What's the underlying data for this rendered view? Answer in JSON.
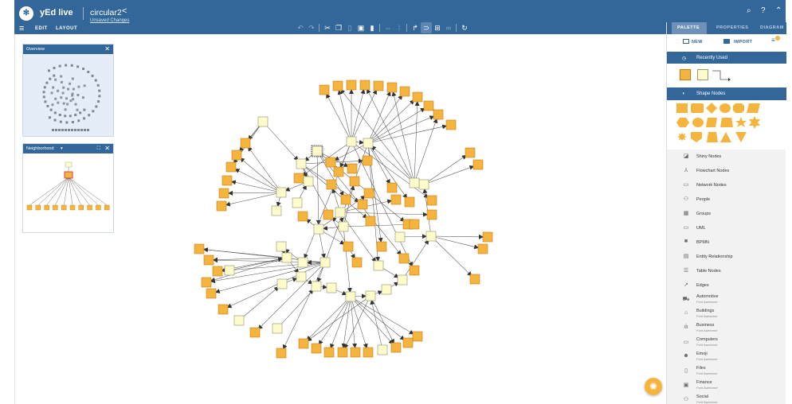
{
  "header": {
    "app_name": "yEd live",
    "document_name": "circular2",
    "unsaved": "Unsaved Changes",
    "menu_edit": "EDIT",
    "menu_layout": "LAYOUT"
  },
  "toolbar": {
    "icons": [
      "undo-icon",
      "redo-icon",
      "cut-icon",
      "copy-icon",
      "paste-icon",
      "group-icon",
      "delete-icon",
      "fit-icon",
      "grid-icon",
      "edge-icon",
      "snap-icon",
      "table-icon",
      "link-icon",
      "refresh-icon"
    ]
  },
  "right_tabs": [
    "PALETTE",
    "PROPERTIES",
    "DIAGRAM"
  ],
  "palette": {
    "new_label": "NEW",
    "import_label": "IMPORT",
    "recently_used": "Recently Used",
    "shape_nodes": "Shape Nodes",
    "items": [
      {
        "label": "Shiny Nodes",
        "icon": "shiny-icon"
      },
      {
        "label": "Flowchart Nodes",
        "icon": "flowchart-icon"
      },
      {
        "label": "Network Nodes",
        "icon": "network-icon"
      },
      {
        "label": "People",
        "icon": "people-icon"
      },
      {
        "label": "Groups",
        "icon": "groups-icon"
      },
      {
        "label": "UML",
        "icon": "uml-icon"
      },
      {
        "label": "BPMN",
        "icon": "bpmn-icon"
      },
      {
        "label": "Entity Relationship",
        "icon": "entity-icon"
      },
      {
        "label": "Table Nodes",
        "icon": "table-icon"
      },
      {
        "label": "Edges",
        "icon": "edges-icon"
      }
    ],
    "fa_items": [
      {
        "label": "Automotive",
        "sub": "Font Awesome",
        "icon": "car-icon"
      },
      {
        "label": "Buildings",
        "sub": "Font Awesome",
        "icon": "building-icon"
      },
      {
        "label": "Business",
        "sub": "Font Awesome",
        "icon": "chart-icon"
      },
      {
        "label": "Computers",
        "sub": "Font Awesome",
        "icon": "laptop-icon"
      },
      {
        "label": "Emoji",
        "sub": "Font Awesome",
        "icon": "emoji-icon"
      },
      {
        "label": "Files",
        "sub": "Font Awesome",
        "icon": "file-icon"
      },
      {
        "label": "Finance",
        "sub": "Font Awesome",
        "icon": "money-icon"
      },
      {
        "label": "Social",
        "sub": "Font Awesome",
        "icon": "social-icon"
      }
    ]
  },
  "overview": {
    "title": "Overview"
  },
  "neighborhood": {
    "title": "Neighborhood"
  },
  "colors": {
    "header": "#336699",
    "node_orange": "#F5B43E",
    "node_cream": "#FFFCCB",
    "node_stroke": "#C07F1A"
  }
}
